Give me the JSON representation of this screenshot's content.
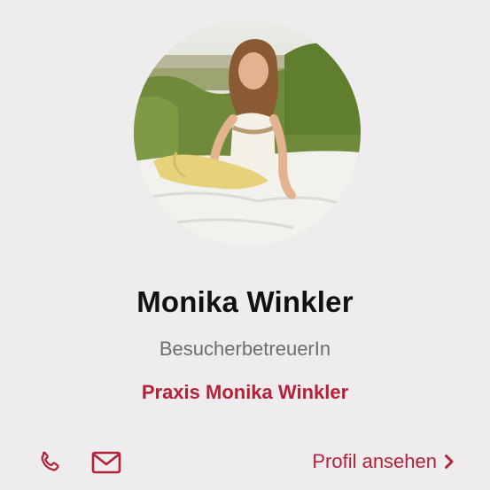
{
  "profile": {
    "name": "Monika Winkler",
    "role": "BesucherbetreuerIn",
    "organization": "Praxis Monika Winkler",
    "photo_icon": "profile-photo"
  },
  "actions": {
    "phone_icon": "phone-icon",
    "email_icon": "mail-icon",
    "profile_link_label": "Profil ansehen",
    "chevron_icon": "chevron-right-icon"
  },
  "colors": {
    "background": "#eeeced",
    "accent": "#b3213a",
    "name_text": "#111111",
    "role_text": "#6e6e6e"
  }
}
